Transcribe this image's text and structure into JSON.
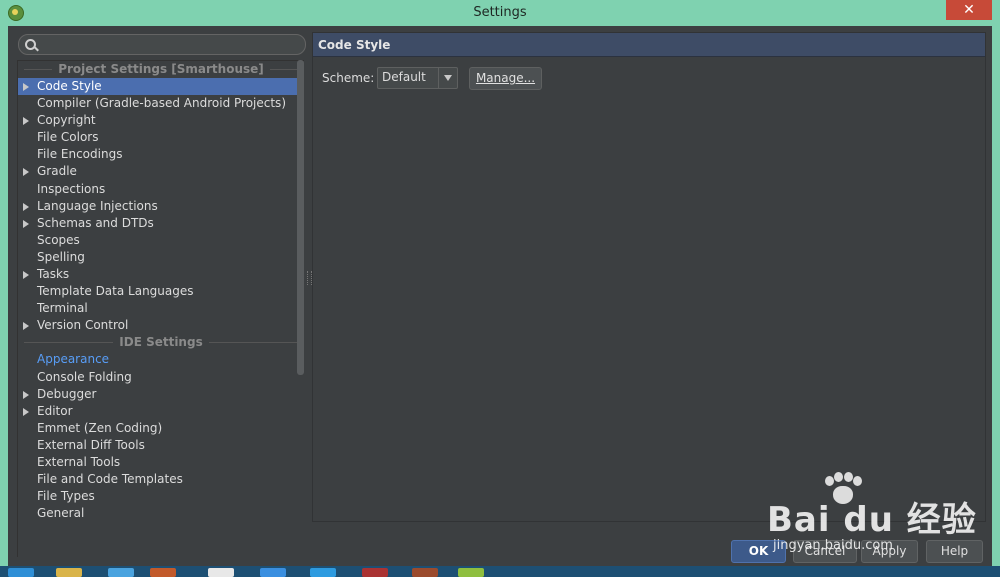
{
  "window": {
    "title": "Settings",
    "close_glyph": "✕"
  },
  "search": {
    "placeholder": ""
  },
  "tree": {
    "project_header": "Project Settings [Smarthouse]",
    "project_items": [
      {
        "label": "Code Style",
        "expandable": true,
        "selected": true
      },
      {
        "label": "Compiler (Gradle-based Android Projects)",
        "expandable": false
      },
      {
        "label": "Copyright",
        "expandable": true
      },
      {
        "label": "File Colors",
        "expandable": false
      },
      {
        "label": "File Encodings",
        "expandable": false
      },
      {
        "label": "Gradle",
        "expandable": true
      },
      {
        "label": "Inspections",
        "expandable": false
      },
      {
        "label": "Language Injections",
        "expandable": true
      },
      {
        "label": "Schemas and DTDs",
        "expandable": true
      },
      {
        "label": "Scopes",
        "expandable": false
      },
      {
        "label": "Spelling",
        "expandable": false
      },
      {
        "label": "Tasks",
        "expandable": true
      },
      {
        "label": "Template Data Languages",
        "expandable": false
      },
      {
        "label": "Terminal",
        "expandable": false
      },
      {
        "label": "Version Control",
        "expandable": true
      }
    ],
    "ide_header": "IDE Settings",
    "ide_items": [
      {
        "label": "Appearance",
        "expandable": false,
        "highlighted": true
      },
      {
        "label": "Console Folding",
        "expandable": false
      },
      {
        "label": "Debugger",
        "expandable": true
      },
      {
        "label": "Editor",
        "expandable": true
      },
      {
        "label": "Emmet (Zen Coding)",
        "expandable": false
      },
      {
        "label": "External Diff Tools",
        "expandable": false
      },
      {
        "label": "External Tools",
        "expandable": false
      },
      {
        "label": "File and Code Templates",
        "expandable": false
      },
      {
        "label": "File Types",
        "expandable": false
      },
      {
        "label": "General",
        "expandable": false
      }
    ]
  },
  "content": {
    "header": "Code Style",
    "scheme_label": "Scheme:",
    "scheme_value": "Default",
    "manage_label": "Manage..."
  },
  "buttons": {
    "ok": "OK",
    "cancel": "Cancel",
    "apply": "Apply",
    "help": "Help"
  },
  "watermark": {
    "brand": "Bai du 经验",
    "url": "jingyan.baidu.com"
  },
  "colors": {
    "selection": "#4b6eaf",
    "link": "#589df6",
    "header": "#3e4c66",
    "background": "#3c3f41"
  }
}
